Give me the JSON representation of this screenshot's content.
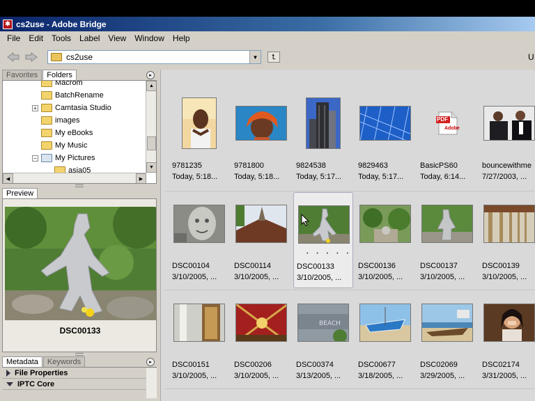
{
  "window": {
    "title": "cs2use - Adobe Bridge"
  },
  "menu": [
    "File",
    "Edit",
    "Tools",
    "Label",
    "View",
    "Window",
    "Help"
  ],
  "toolbar": {
    "path": "cs2use",
    "right_edge_text": "U"
  },
  "left": {
    "tabs_top": [
      "Favorites",
      "Folders"
    ],
    "folders": [
      {
        "label": "Macrom",
        "type": "folder",
        "expander": ""
      },
      {
        "label": "BatchRename",
        "type": "folder",
        "expander": ""
      },
      {
        "label": "Camtasia Studio",
        "type": "folder",
        "expander": "+"
      },
      {
        "label": "images",
        "type": "folder",
        "expander": ""
      },
      {
        "label": "My eBooks",
        "type": "folder",
        "expander": ""
      },
      {
        "label": "My Music",
        "type": "folder",
        "expander": ""
      },
      {
        "label": "My Pictures",
        "type": "pictures",
        "expander": "−"
      },
      {
        "label": "asia05",
        "type": "folder",
        "expander": ""
      }
    ],
    "preview_tab": "Preview",
    "preview_name": "DSC00133",
    "tabs_bottom": [
      "Metadata",
      "Keywords"
    ],
    "meta_sections": [
      {
        "label": "File Properties",
        "expanded": false
      },
      {
        "label": "IPTC Core",
        "expanded": true
      }
    ]
  },
  "thumbnails": [
    [
      {
        "name": "9781235",
        "date": "Today, 5:18...",
        "kind": "portrait-man"
      },
      {
        "name": "9781800",
        "date": "Today, 5:18...",
        "kind": "woman-scarf"
      },
      {
        "name": "9824538",
        "date": "Today, 5:17...",
        "kind": "tower"
      },
      {
        "name": "9829463",
        "date": "Today, 5:17...",
        "kind": "glass"
      },
      {
        "name": "BasicPS60",
        "date": "Today, 6:14...",
        "kind": "pdf"
      },
      {
        "name": "bouncewithme",
        "date": "7/27/2003, ...",
        "kind": "two-men"
      }
    ],
    [
      {
        "name": "DSC00104",
        "date": "3/10/2005, ...",
        "kind": "statue-face"
      },
      {
        "name": "DSC00114",
        "date": "3/10/2005, ...",
        "kind": "temple-roof"
      },
      {
        "name": "DSC00133",
        "date": "3/10/2005, ...",
        "kind": "statue-green",
        "selected": true
      },
      {
        "name": "DSC00136",
        "date": "3/10/2005, ...",
        "kind": "garden"
      },
      {
        "name": "DSC00137",
        "date": "3/10/2005, ...",
        "kind": "statue-garden"
      },
      {
        "name": "DSC00139",
        "date": "3/10/2005, ...",
        "kind": "corridor"
      }
    ],
    [
      {
        "name": "DSC00151",
        "date": "3/10/2005, ...",
        "kind": "pillars"
      },
      {
        "name": "DSC00206",
        "date": "3/10/2005, ...",
        "kind": "red-ceiling"
      },
      {
        "name": "DSC00374",
        "date": "3/13/2005, ...",
        "kind": "beach-sign"
      },
      {
        "name": "DSC00677",
        "date": "3/18/2005, ...",
        "kind": "boat-blue"
      },
      {
        "name": "DSC02069",
        "date": "3/29/2005, ...",
        "kind": "boat-beach"
      },
      {
        "name": "DSC02174",
        "date": "3/31/2005, ...",
        "kind": "woman-laugh"
      }
    ]
  ],
  "colors": {
    "title_start": "#0a246a",
    "title_end": "#a6caf0",
    "content_bg": "#d9d9d9",
    "chrome": "#d4d0c8"
  },
  "icons": {
    "back": "back-arrow-icon",
    "forward": "forward-arrow-icon",
    "up": "up-folder-icon",
    "pdf_label": "PDF",
    "pdf_brand": "Adobe"
  }
}
